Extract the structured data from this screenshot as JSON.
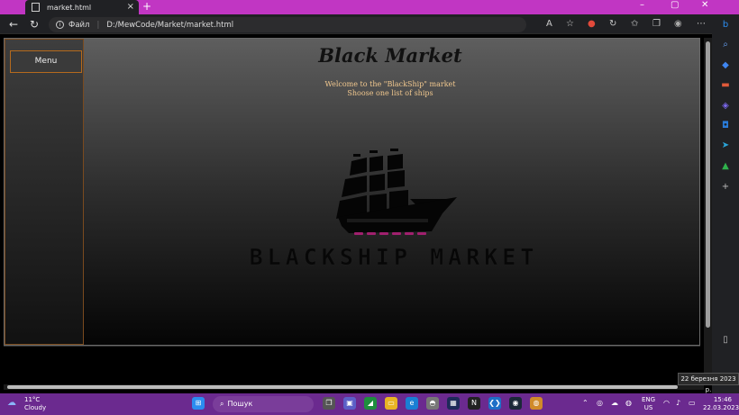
{
  "browser": {
    "tab_title": "market.html",
    "tab_close": "×",
    "new_tab": "+",
    "window_controls": {
      "minimize": "–",
      "maximize": "▢",
      "close": "✕"
    },
    "address": {
      "protocol_label": "Файл",
      "url": "D:/MewCode/Market/market.html"
    },
    "toolbar_icons": [
      "read-aloud-icon",
      "favorite-star-icon",
      "extension-red-icon",
      "refresh-alt-icon",
      "favorites-icon",
      "collections-icon",
      "profile-avatar-icon",
      "more-icon"
    ],
    "sidebar_icons": [
      "bing-icon",
      "search-icon",
      "tag-icon",
      "toolbox-icon",
      "copilot-icon",
      "outlook-icon",
      "send-icon",
      "tree-icon",
      "add-icon",
      "split-icon"
    ]
  },
  "page": {
    "menu_label": "Menu",
    "headline": "Black Market",
    "welcome_line1": "Welcome to the \"BlackShip\" market",
    "welcome_line2": "Shoose one list of ships",
    "logo_text": "BLACKSHIP MARKET"
  },
  "tooltip": "22 березня 2023 р.",
  "taskbar": {
    "weather_temp": "11°C",
    "weather_desc": "Cloudy",
    "search_label": "Пошук",
    "lang_top": "ENG",
    "lang_bottom": "US",
    "time": "15:46",
    "date": "22.03.2023"
  },
  "colors": {
    "tab_strip": "#c136c3",
    "menu_border": "#b56a1d",
    "welcome_text": "#f0c78e",
    "taskbar": "#6b2a8f"
  }
}
